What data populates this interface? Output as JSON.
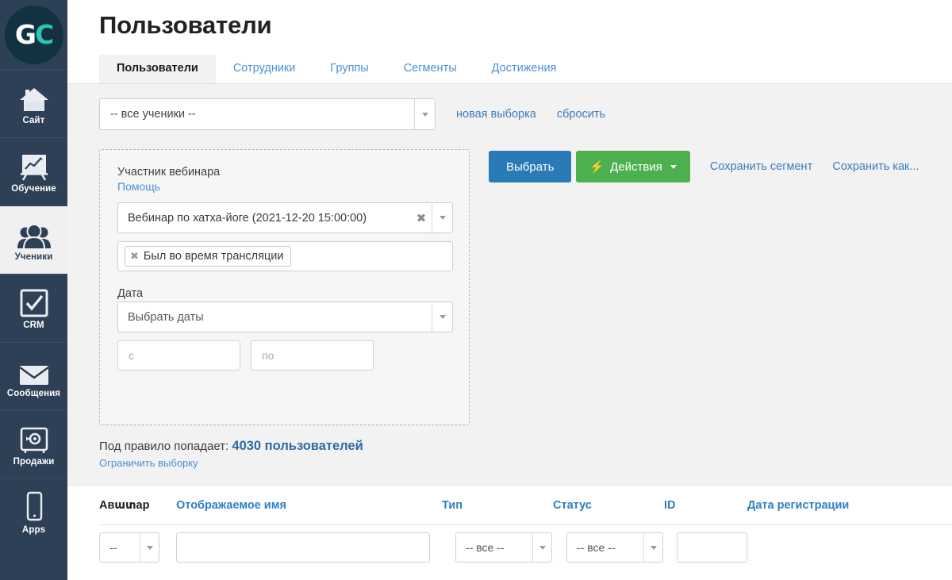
{
  "sidebar": {
    "logo": {
      "first": "G",
      "second": "C",
      "name": "gc-logo"
    },
    "items": [
      {
        "label": "Сайт",
        "icon": "home-icon",
        "active": false
      },
      {
        "label": "Обучение",
        "icon": "chart-board-icon",
        "active": false
      },
      {
        "label": "Ученики",
        "icon": "users-icon",
        "active": true
      },
      {
        "label": "CRM",
        "icon": "checkbox-check-icon",
        "active": false
      },
      {
        "label": "Сообщения",
        "icon": "envelope-icon",
        "active": false
      },
      {
        "label": "Продажи",
        "icon": "safe-icon",
        "active": false
      },
      {
        "label": "Apps",
        "icon": "mobile-phone-icon",
        "active": false
      }
    ]
  },
  "header": {
    "title": "Пользователи",
    "tabs": [
      {
        "label": "Пользователи",
        "active": true
      },
      {
        "label": "Сотрудники",
        "active": false
      },
      {
        "label": "Группы",
        "active": false
      },
      {
        "label": "Сегменты",
        "active": false
      },
      {
        "label": "Достижения",
        "active": false
      }
    ]
  },
  "top_row": {
    "select_value": "-- все ученики --",
    "new_selection_link": "новая выборка",
    "reset_link": "сбросить"
  },
  "filter_panel": {
    "section_label": "Участник вебинара",
    "help_link": "Помощь",
    "webinar_value": "Вебинар по хатха-йоге (2021-12-20 15:00:00)",
    "clear_glyph": "✖",
    "tags": [
      {
        "label": "Был во время трансляции",
        "remove_glyph": "✖"
      }
    ],
    "date_label": "Дата",
    "date_select_value": "Выбрать даты",
    "date_from_placeholder": "с",
    "date_to_placeholder": "по"
  },
  "actions": {
    "select_button": "Выбрать",
    "actions_button": "Действия",
    "actions_icon": "lightning-bolt-icon",
    "save_segment_link": "Сохранить сегмент",
    "save_as_link": "Сохранить как..."
  },
  "summary": {
    "prefix": "Под правило попадает:",
    "count": "4030 пользователей",
    "limit_link": "Ограничить выборку"
  },
  "table": {
    "columns": [
      {
        "label": "Авատар",
        "plain": true
      },
      {
        "label": "Отображаемое имя",
        "plain": false
      },
      {
        "label": "Тип",
        "plain": false
      },
      {
        "label": "Статус",
        "plain": false
      },
      {
        "label": "ID",
        "plain": false
      },
      {
        "label": "Дата регистрации",
        "plain": false
      }
    ],
    "filters": {
      "avatar_value": "--",
      "name_value": "",
      "type_value": "-- все --",
      "status_value": "-- все --",
      "id_value": ""
    }
  },
  "colors": {
    "sidebar_bg": "#2e4055",
    "logo_bg": "#123141",
    "logo_accent": "#2ec4b0",
    "primary_button": "#2b7ab8",
    "success_button": "#4cb04f",
    "link_blue": "#3c7cb8",
    "content_bg": "#f2f2f2"
  }
}
